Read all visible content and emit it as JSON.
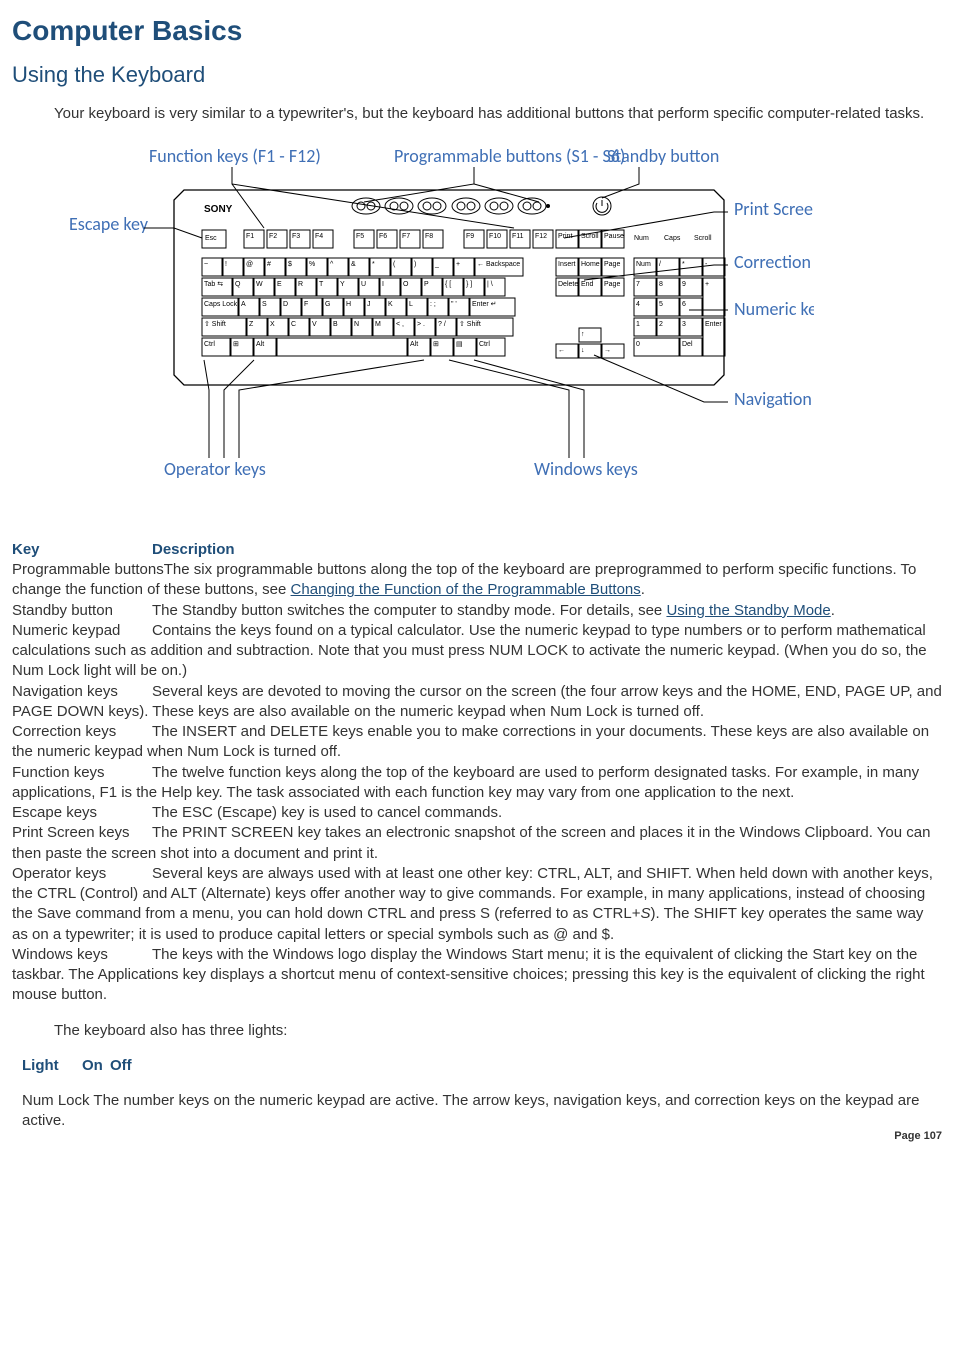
{
  "title": "Computer Basics",
  "subtitle": "Using the Keyboard",
  "intro": "Your keyboard is very similar to a typewriter's, but the keyboard has additional buttons that perform specific computer-related tasks.",
  "diagram": {
    "brand": "SONY",
    "callouts": {
      "function_keys": "Function keys (F1 - F12)",
      "programmable": "Programmable buttons (S1 - S6)",
      "standby": "Standby button",
      "escape": "Escape key",
      "print_screen": "Print Screen key",
      "correction": "Correction keys",
      "numeric": "Numeric keypad",
      "navigation": "Navigation keys",
      "operator": "Operator keys",
      "windows": "Windows keys"
    },
    "keys": {
      "escape": "Esc",
      "frow": [
        "F1",
        "F2",
        "F3",
        "F4",
        "F5",
        "F6",
        "F7",
        "F8",
        "F9",
        "F10",
        "F11",
        "F12"
      ],
      "sysrow": [
        "Print Screen",
        "Scroll Lock",
        "Pause"
      ],
      "lights": [
        "Num Lock",
        "Caps Lock",
        "Scroll Lock"
      ],
      "num_top": [
        "~ `",
        "! 1",
        "@ 2",
        "# 3",
        "$ 4",
        "% 5",
        "^ 6",
        "& 7",
        "* 8",
        "( 9",
        ") 0",
        "_ -",
        "+ ="
      ],
      "backspace": "← Backspace",
      "tab": "Tab ⇆",
      "qrow": [
        "Q",
        "W",
        "E",
        "R",
        "T",
        "Y",
        "U",
        "I",
        "O",
        "P",
        "{ [",
        "} ]",
        "| \\"
      ],
      "caps": "Caps Lock",
      "arow": [
        "A",
        "S",
        "D",
        "F",
        "G",
        "H",
        "J",
        "K",
        "L",
        ": ;",
        "\" '"
      ],
      "enter": "Enter ↵",
      "lshift": "⇧ Shift",
      "zrow": [
        "Z",
        "X",
        "C",
        "V",
        "B",
        "N",
        "M",
        "< ,",
        "> .",
        "? /"
      ],
      "rshift": "⇧ Shift",
      "bottom": [
        "Ctrl",
        "⊞",
        "Alt",
        "",
        "Alt",
        "⊞",
        "▤",
        "Ctrl"
      ],
      "nav1": [
        "Insert",
        "Home",
        "Page Up"
      ],
      "nav2": [
        "Delete",
        "End",
        "Page Down"
      ],
      "arrows": [
        "↑",
        "←",
        "↓",
        "→"
      ],
      "keypad": [
        [
          "Num Lock",
          "/",
          "*",
          "-"
        ],
        [
          "7 Home",
          "8 ↑",
          "9 PgUp"
        ],
        [
          "4 ←",
          "5",
          "6 →",
          "+"
        ],
        [
          "1 End",
          "2 ↓",
          "3 PgDn"
        ],
        [
          "0 Ins",
          "",
          "Del",
          "Enter"
        ]
      ]
    }
  },
  "table_headers": {
    "key": "Key",
    "description": "Description"
  },
  "rows": [
    {
      "key": "Programmable buttons",
      "desc_pre": "The six programmable buttons along the top of the keyboard are preprogrammed to perform specific functions. To change the function of these buttons, see ",
      "link": "Changing the Function of the Programmable Buttons",
      "desc_post": "."
    },
    {
      "key": "Standby button",
      "desc_pre": "The Standby button switches the computer to standby mode. For details, see ",
      "link": "Using the Standby Mode",
      "desc_post": "."
    },
    {
      "key": "Numeric keypad",
      "desc": "Contains the keys found on a typical calculator. Use the numeric keypad to type numbers or to perform mathematical calculations such as addition and subtraction. Note that you must press NUM LOCK to activate the numeric keypad. (When you do so, the Num Lock light will be on.)"
    },
    {
      "key": "Navigation keys",
      "desc": "Several keys are devoted to moving the cursor on the screen (the four arrow keys and the HOME, END, PAGE UP, and PAGE DOWN keys). These keys are also available on the numeric keypad when Num Lock is turned off."
    },
    {
      "key": "Correction keys",
      "desc": "The INSERT and DELETE keys enable you to make corrections in your documents. These keys are also available on the numeric keypad when Num Lock is turned off."
    },
    {
      "key": "Function keys",
      "desc": "The twelve function keys along the top of the keyboard are used to perform designated tasks. For example, in many applications, F1 is the Help key. The task associated with each function key may vary from one application to the next."
    },
    {
      "key": "Escape keys",
      "desc": "The ESC (Escape) key is used to cancel commands."
    },
    {
      "key": "Print Screen keys",
      "desc": "The PRINT SCREEN key takes an electronic snapshot of the screen and places it in the Windows Clipboard. You can then paste the screen shot into a document and print it."
    },
    {
      "key": "Operator keys",
      "desc": "Several keys are always used with at least one other key: CTRL, ALT, and SHIFT. When held down with another keys, the CTRL (Control) and ALT (Alternate) keys offer another way to give commands. For example, in many applications, instead of choosing the Save command from a menu, you can hold down CTRL and press S (referred to as CTRL+",
      "italic": "S",
      "desc_post2": "). The SHIFT key operates the same way as on a typewriter; it is used to produce capital letters or special symbols such as @ and $."
    },
    {
      "key": "Windows keys",
      "desc": "The keys with the Windows logo display the Windows Start menu; it is the equivalent of clicking the Start key on the taskbar. The Applications key displays a shortcut menu of context-sensitive choices; pressing this key is the equivalent of clicking the right mouse button."
    }
  ],
  "lights_intro": "The keyboard also has three lights:",
  "lights_headers": {
    "light": "Light",
    "on": "On",
    "off": "Off"
  },
  "lights_rows": [
    {
      "light": "Num Lock",
      "on": "The number keys on the numeric keypad are active.",
      "off": "The arrow keys, navigation keys, and correction keys on the keypad are active."
    }
  ],
  "page_number": "Page 107"
}
